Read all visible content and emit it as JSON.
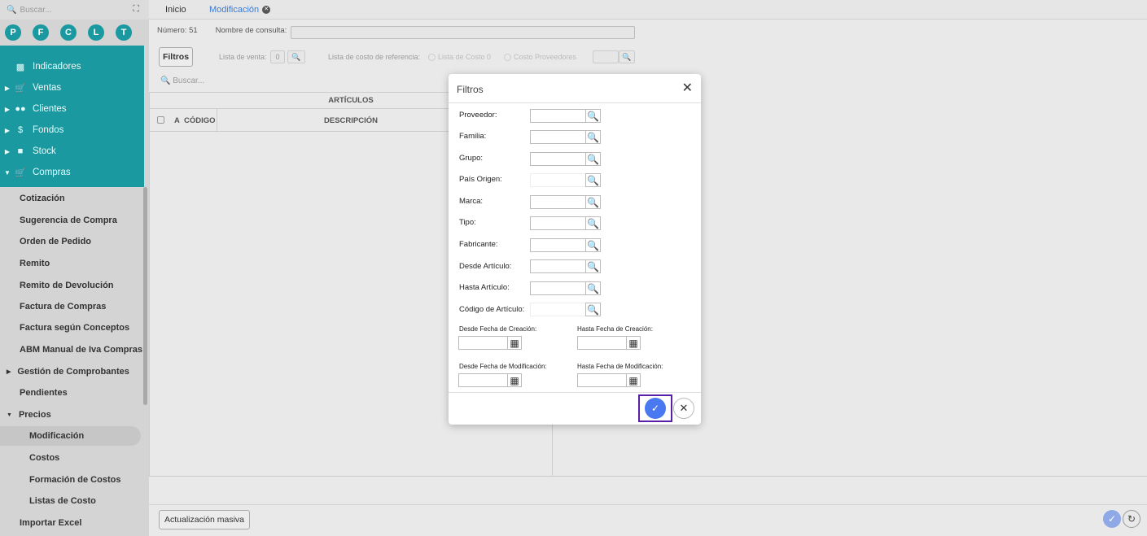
{
  "sidebar": {
    "search_placeholder": "Buscar...",
    "avatars": [
      "P",
      "F",
      "C",
      "L",
      "T"
    ],
    "menu": [
      {
        "label": "Indicadores",
        "icon": "dashboard-icon"
      },
      {
        "label": "Ventas",
        "icon": "cart-icon"
      },
      {
        "label": "Clientes",
        "icon": "users-icon"
      },
      {
        "label": "Fondos",
        "icon": "dollar-icon"
      },
      {
        "label": "Stock",
        "icon": "box-icon"
      },
      {
        "label": "Compras",
        "icon": "cart-off-icon"
      }
    ],
    "compras_items": [
      "Cotización",
      "Sugerencia de Compra",
      "Orden de Pedido",
      "Remito",
      "Remito de Devolución",
      "Factura de Compras",
      "Factura según Conceptos",
      "ABM Manual de Iva Compras"
    ],
    "gestion": "Gestión de Comprobantes",
    "pendientes": "Pendientes",
    "precios": "Precios",
    "precios_items": [
      "Modificación",
      "Costos",
      "Formación de Costos",
      "Listas de Costo"
    ],
    "importar": "Importar Excel"
  },
  "tabs": [
    "Inicio",
    "Modificación"
  ],
  "toolbar": {
    "numero": "Número: 51",
    "consulta_label": "Nombre de consulta:",
    "filtros": "Filtros",
    "lista_venta": "Lista de venta:",
    "lista_venta_val": "0",
    "lista_costo": "Lista de costo de referencia:",
    "lista_costo_0": "Lista de Costo 0",
    "costo_prov": "Costo Proveedores",
    "search": "Buscar..."
  },
  "grid": {
    "title": "ARTÍCULOS",
    "col_a": "A",
    "col_codigo": "CÓDIGO",
    "col_desc": "DESCRIPCIÓN"
  },
  "bottom": {
    "masiva": "Actualización masiva"
  },
  "dialog": {
    "title": "Filtros",
    "fields": [
      "Proveedor:",
      "Familia:",
      "Grupo:",
      "País Origen:",
      "Marca:",
      "Tipo:",
      "Fabricante:",
      "Desde Artículo:",
      "Hasta Artículo:",
      "Código de Artículo:"
    ],
    "desde_creacion": "Desde Fecha de Creación:",
    "hasta_creacion": "Hasta Fecha de Creación:",
    "desde_mod": "Desde Fecha de Modificación:",
    "hasta_mod": "Hasta Fecha de Modificación:"
  },
  "colors": {
    "teal": "#1a9aa0",
    "accent": "#4a78f0",
    "highlight": "#5a1fa8"
  }
}
